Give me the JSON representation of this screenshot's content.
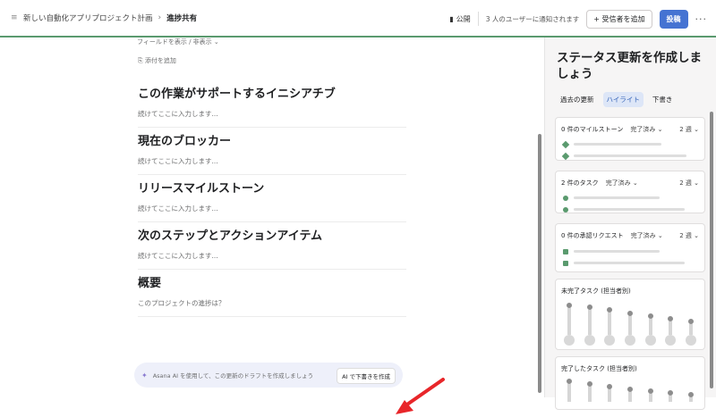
{
  "breadcrumb": {
    "project": "新しい自動化アプリプロジェクト計画",
    "current": "進捗共有"
  },
  "header": {
    "public_label": "公開",
    "notify_text": "3 人のユーザーに通知されます",
    "add_recipient_label": "受信者を追加",
    "post_label": "投稿",
    "more_label": "···"
  },
  "editor": {
    "fields_toggle": "フィールドを表示 / 非表示",
    "attach": "添付を追加",
    "sections": [
      {
        "title": "この作業がサポートするイニシアチブ",
        "placeholder": "続けてここに入力します..."
      },
      {
        "title": "現在のブロッカー",
        "placeholder": "続けてここに入力します..."
      },
      {
        "title": "リリースマイルストーン",
        "placeholder": "続けてここに入力します..."
      },
      {
        "title": "次のステップとアクションアイテム",
        "placeholder": "続けてここに入力します..."
      },
      {
        "title": "概要",
        "placeholder": "このプロジェクトの進捗は？"
      }
    ],
    "ai_hint": "Asana AI を使用して、この更新のドラフトを作成しましょう",
    "ai_button": "AI で下書きを作成"
  },
  "panel": {
    "title": "ステータス更新を作成しましょう",
    "tabs": [
      "過去の更新",
      "ハイライト",
      "下書き"
    ],
    "active_tab": 1,
    "cards": [
      {
        "title": "0 件のマイルストーン",
        "filter": "完了済み",
        "window": "2 週"
      },
      {
        "title": "2 件のタスク",
        "filter": "完了済み",
        "window": "2 週"
      },
      {
        "title": "0 件の承認リクエスト",
        "filter": "完了済み",
        "window": "2 週"
      }
    ],
    "chart_titles": [
      "未完了タスク (担当者別)",
      "完了したタスク (担当者別)"
    ]
  },
  "colors": {
    "accent": "#4573d2",
    "green": "#5a9a6e",
    "arrow": "#e8262a"
  }
}
